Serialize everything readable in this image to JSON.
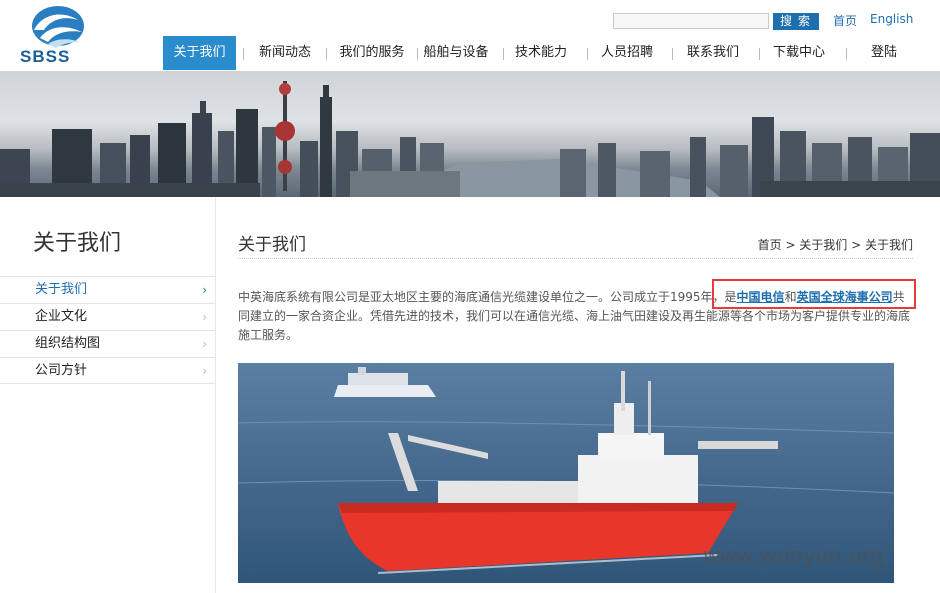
{
  "header": {
    "logo_text": "SBSS",
    "search_button": "搜索",
    "home_link": "首页",
    "english_link": "English",
    "nav": [
      "关于我们",
      "新闻动态",
      "我们的服务",
      "船舶与设备",
      "技术能力",
      "人员招聘",
      "联系我们",
      "下载中心",
      "登陆"
    ]
  },
  "sidebar": {
    "title": "关于我们",
    "items": [
      "关于我们",
      "企业文化",
      "组织结构图",
      "公司方针"
    ]
  },
  "content": {
    "title": "关于我们",
    "breadcrumb": "首页 > 关于我们 > 关于我们",
    "para_part1": "中英海底系统有限公司是亚太地区主要的海底通信光缆建设单位之一。公司成立于1995年，是",
    "link1": "中国电信",
    "para_and": "和",
    "link2": "英国全球海事公司",
    "para_part2": "共同建立的一家合资企业。凭借先进的技术，我们可以在通信光缆、海上油气田建设及再生能源等各个市场为客户提供专业的海底施工服务。"
  },
  "watermark": "www.wooyun.org",
  "colors": {
    "accent": "#1d6fae",
    "nav_active": "#2a8ccc",
    "highlight_box": "#e53b3b",
    "ship_hull": "#e8362b"
  }
}
